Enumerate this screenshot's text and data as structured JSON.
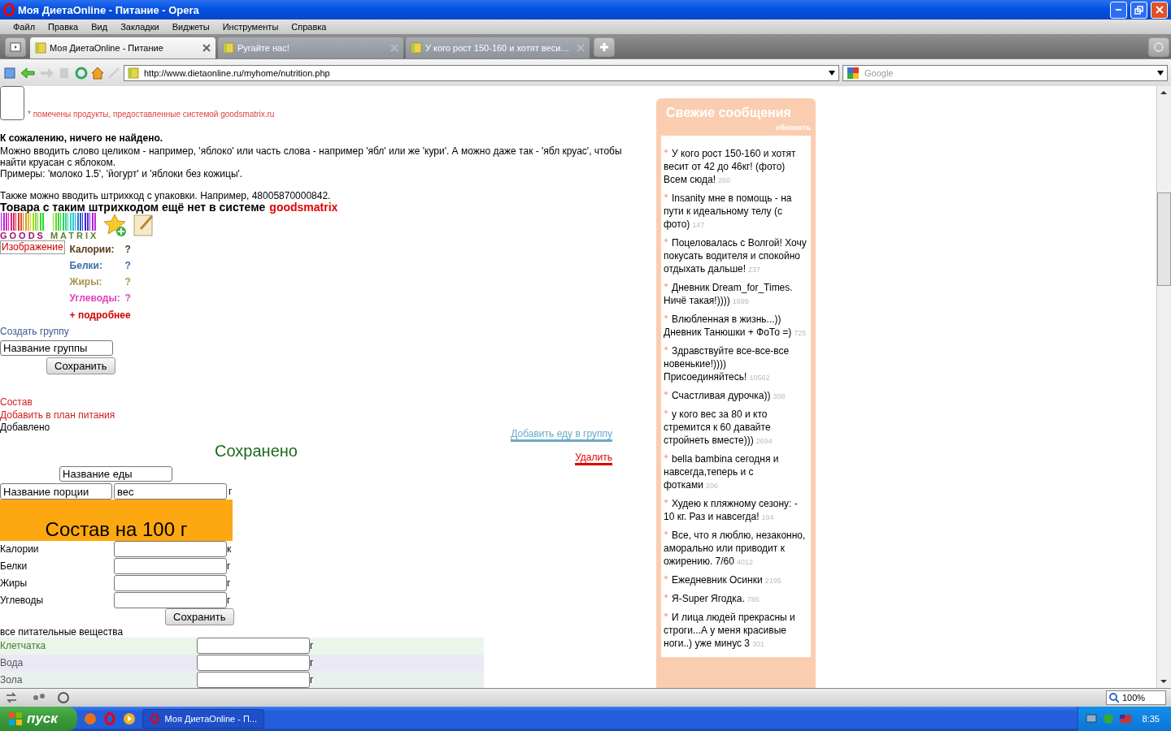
{
  "window": {
    "title": "Моя ДиетаOnline - Питание - Opera"
  },
  "menu": [
    "Файл",
    "Правка",
    "Вид",
    "Закладки",
    "Виджеты",
    "Инструменты",
    "Справка"
  ],
  "tabs": [
    {
      "label": "Моя ДиетаOnline - Питание",
      "selected": true
    },
    {
      "label": "Ругайте нас!",
      "selected": false
    },
    {
      "label": "У кого рост 150-160 и хотят веси…",
      "selected": false
    }
  ],
  "address": {
    "url": "http://www.dietaonline.ru/myhome/nutrition.php"
  },
  "search": {
    "placeholder": "Google"
  },
  "page": {
    "note": "* помечены продукты, предоставленные системой goodsmatrix.ru",
    "not_found": "К сожалению, ничего не найдено.",
    "hint": "Можно вводить слово целиком - например, 'яблоко' или часть слова - например 'ябл' или же 'кури'. А можно даже так - 'ябл круас', чтобы найти круасан с яблоком.",
    "examples": "Примеры: 'молоко 1.5', 'йогурт' и 'яблоки без кожицы'.",
    "barcode_note": "Также можно вводить штрихкод с упаковки. Например, 48005870000842.",
    "missing": {
      "text": "Товара с таким штрихкодом ещё нет в системе",
      "brand": "goodsmatrix"
    },
    "logo": {
      "left": "GOODS",
      "right": "MATRIX"
    },
    "image_alt": "Изображение",
    "nutrients": [
      {
        "label": "Калории:",
        "value": "?",
        "color": "#5b3b17"
      },
      {
        "label": "Белки:",
        "value": "?",
        "color": "#3a6ea5"
      },
      {
        "label": "Жиры:",
        "value": "?",
        "color": "#a8924a"
      },
      {
        "label": "Углеводы:",
        "value": "?",
        "color": "#e040b8"
      }
    ],
    "more": "+ подробнее",
    "group": {
      "link": "Создать группу",
      "value": "Название группы",
      "button": "Сохранить"
    },
    "links": [
      "Состав",
      "Добавить в план питания"
    ],
    "added": "Добавлено",
    "add_to_group": "Добавить еду в группу",
    "delete": "Удалить",
    "saved": "Сохранено",
    "food_name": "Название еды",
    "portion_name": "Название порции",
    "weight": "вес",
    "weight_unit": "г",
    "composition": "Состав на 100 г",
    "macros": [
      {
        "label": "Калории",
        "unit": "к"
      },
      {
        "label": "Белки",
        "unit": "г"
      },
      {
        "label": "Жиры",
        "unit": "г"
      },
      {
        "label": "Углеводы",
        "unit": "г"
      }
    ],
    "save": "Сохранить",
    "all_nutrients": "все питательные вещества",
    "nutrient_rows": [
      {
        "label": "Клетчатка",
        "unit": "г",
        "color": "#eaf6ea"
      },
      {
        "label": "Вода",
        "unit": "г",
        "color": "#ebe8f5"
      },
      {
        "label": "Зола",
        "unit": "г",
        "color": "#eaf0ee"
      }
    ]
  },
  "sidebar": {
    "title": "Свежие сообщения",
    "refresh": "обновить",
    "posts": [
      {
        "text": "У кого рост 150-160 и хотят весит от 42 до 46кг! (фото) Всем сюда!",
        "count": "260"
      },
      {
        "text": "Insanity мне в помощь - на пути к идеальному телу (с фото)",
        "count": "147"
      },
      {
        "text": "Поцеловалась с Волгой! Хочу покусать водителя и спокойно отдыхать дальше!",
        "count": "237"
      },
      {
        "text": "Дневник Dream_for_Times. Ничё такая!))))",
        "count": "1699"
      },
      {
        "text": "Влюбленная в жизнь...)) Дневник Танюшки + ФоТо =)",
        "count": "725"
      },
      {
        "text": "Здравствуйте все-все-все новенькие!)))) Присоединяйтесь!",
        "count": "10562"
      },
      {
        "text": "Счастливая дурочка))",
        "count": "308"
      },
      {
        "text": "у кого вес за 80 и кто стремится к 60 давайте стройнеть вместе)))",
        "count": "2694"
      },
      {
        "text": "bella bambina сегодня и навсегда,теперь и с фотками",
        "count": "206"
      },
      {
        "text": "Худею к пляжному сезону: - 10 кг. Раз и навсегда!",
        "count": "104"
      },
      {
        "text": "Все, что я люблю, незаконно, аморально или приводит к ожирению. 7/60",
        "count": "4012"
      },
      {
        "text": "Ежедневник Осинки",
        "count": "2195"
      },
      {
        "text": "Я-Super Ягодка.",
        "count": "786"
      },
      {
        "text": "И лица людей прекрасны и строги...А у меня красивые ноги..) уже минус 3",
        "count": "301"
      }
    ]
  },
  "status_bar": {
    "zoom": "100%"
  },
  "taskbar": {
    "start": "пуск",
    "task": "Моя ДиетаOnline - П...",
    "clock": "8:35"
  }
}
